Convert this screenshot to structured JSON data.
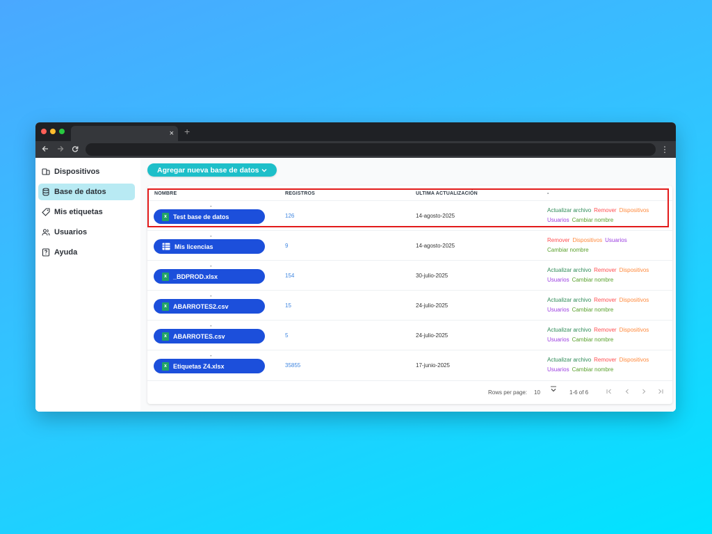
{
  "colors": {
    "accent": "#1dbfc9",
    "file_pill": "#1c4fdb",
    "highlight": "#e21a1a",
    "action_update": "#2e8b57",
    "action_remove": "#ff4d4f",
    "action_devices": "#ff8a3d",
    "action_users": "#9b3fe0",
    "action_rename": "#5aa02c"
  },
  "browser": {
    "tab_close": "×",
    "new_tab": "+",
    "menu": "⋮"
  },
  "sidebar": {
    "items": [
      {
        "label": "Dispositivos",
        "icon": "devices-icon"
      },
      {
        "label": "Base de datos",
        "icon": "database-icon",
        "active": true
      },
      {
        "label": "Mis etiquetas",
        "icon": "tag-icon"
      },
      {
        "label": "Usuarios",
        "icon": "users-icon"
      },
      {
        "label": "Ayuda",
        "icon": "help-icon"
      }
    ]
  },
  "toolbar": {
    "add_label": "Agregar nueva base de datos"
  },
  "table": {
    "headers": [
      "NOMBRE",
      "REGISTROS",
      "ULTIMA ACTUALIZACIÓN",
      "-"
    ],
    "rows": [
      {
        "dash": "-",
        "name": "Test base de datos",
        "icon": "excel-file-icon",
        "records": "126",
        "updated": "14-agosto-2025"
      },
      {
        "dash": "-",
        "name": "Mis licencias",
        "icon": "table-icon",
        "records": "9",
        "updated": "14-agosto-2025"
      },
      {
        "dash": "-",
        "name": "_BDPROD.xlsx",
        "icon": "excel-file-icon",
        "records": "154",
        "updated": "30-julio-2025"
      },
      {
        "dash": "-",
        "name": "ABARROTES2.csv",
        "icon": "excel-file-icon",
        "records": "15",
        "updated": "24-julio-2025"
      },
      {
        "dash": "-",
        "name": "ABARROTES.csv",
        "icon": "excel-file-icon",
        "records": "5",
        "updated": "24-julio-2025"
      },
      {
        "dash": "-",
        "name": "Etiquetas Z4.xlsx",
        "icon": "excel-file-icon",
        "records": "35855",
        "updated": "17-junio-2025"
      }
    ],
    "actions": {
      "update": "Actualizar archivo",
      "remove": "Remover",
      "devices": "Dispositivos",
      "users": "Usuarios",
      "rename": "Cambiar nombre"
    }
  },
  "pagination": {
    "rows_per_page_label": "Rows per page:",
    "rows_per_page_value": "10",
    "range": "1-6 of 6"
  }
}
